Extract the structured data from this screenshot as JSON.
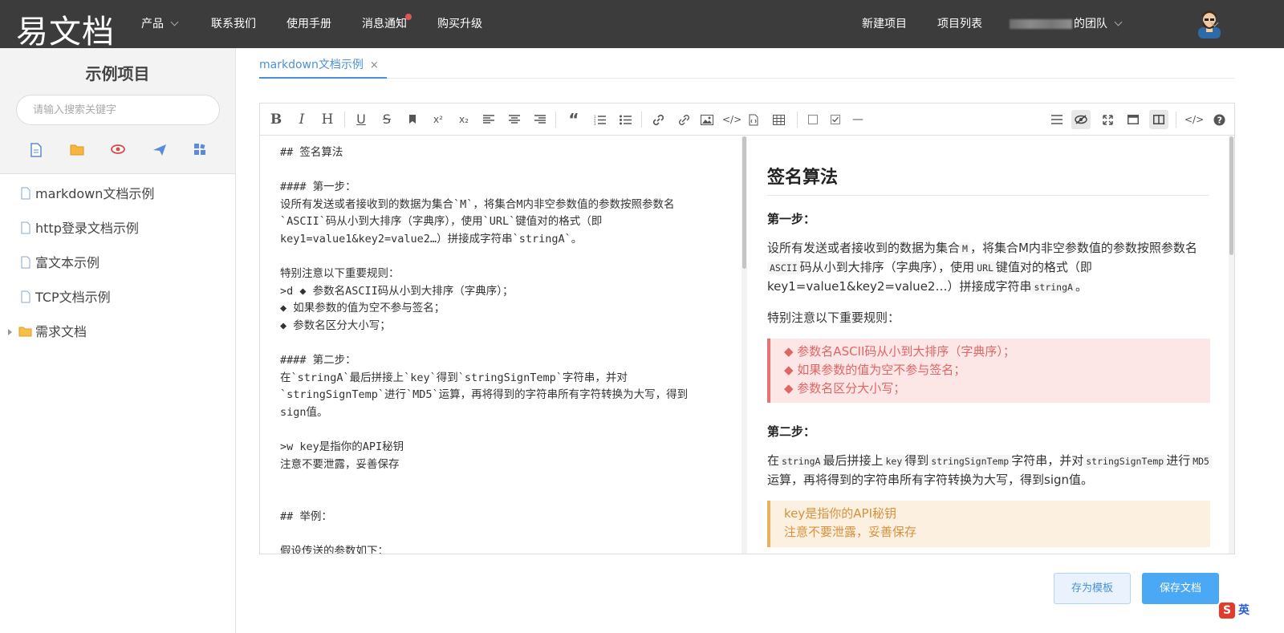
{
  "app": {
    "logo": "易文档",
    "nav": [
      {
        "label": "产品"
      },
      {
        "label": "联系我们"
      },
      {
        "label": "使用手册"
      },
      {
        "label": "消息通知"
      },
      {
        "label": "购买升级"
      }
    ],
    "right_nav": {
      "new_project": "新建项目",
      "project_list": "项目列表",
      "team_suffix": "的团队"
    }
  },
  "sidebar": {
    "title": "示例项目",
    "search_placeholder": "请输入搜索关键字",
    "items": [
      {
        "label": "markdown文档示例",
        "type": "doc"
      },
      {
        "label": "http登录文档示例",
        "type": "doc"
      },
      {
        "label": "富文本示例",
        "type": "doc"
      },
      {
        "label": "TCP文档示例",
        "type": "doc"
      },
      {
        "label": "需求文档",
        "type": "folder"
      }
    ]
  },
  "tab": {
    "label": "markdown文档示例",
    "close": "×"
  },
  "source_lines": [
    "## 签名算法",
    "",
    "#### 第一步：",
    "设所有发送或者接收到的数据为集合`M`，将集合M内非空参数值的参数按照参数名",
    "`ASCII`码从小到大排序（字典序），使用`URL`键值对的格式（即",
    "key1=value1&key2=value2…）拼接成字符串`stringA`。",
    "",
    "特别注意以下重要规则：",
    ">d ◆ 参数名ASCII码从小到大排序（字典序）；",
    "◆ 如果参数的值为空不参与签名；",
    "◆ 参数名区分大小写；",
    "",
    "#### 第二步：",
    "在`stringA`最后拼接上`key`得到`stringSignTemp`字符串，并对",
    "`stringSignTemp`进行`MD5`运算，再将得到的字符串所有字符转换为大写，得到",
    "sign值。",
    "",
    ">w key是指你的API秘钥",
    "注意不要泄露，妥善保存",
    "",
    "",
    "## 举例：",
    "",
    "假设传送的参数如下："
  ],
  "preview": {
    "h2": "签名算法",
    "step1": "第一步：",
    "p1": {
      "a": "设所有发送或者接收到的数据为集合",
      "code_m": "M",
      "b": "，将集合M内非空参数值的参数按照参数名",
      "code_ascii": "ASCII",
      "c": "码从小到大排序（字典序），使用",
      "code_url": "URL",
      "d": "键值对的格式（即key1=value1&key2=value2…）拼接成字符串",
      "code_stringa": "stringA",
      "e": "。"
    },
    "note": "特别注意以下重要规则：",
    "rules": [
      "◆ 参数名ASCII码从小到大排序（字典序）；",
      "◆ 如果参数的值为空不参与签名；",
      "◆ 参数名区分大小写；"
    ],
    "step2": "第二步：",
    "p2": {
      "a": "在",
      "code1": "stringA",
      "b": "最后拼接上",
      "code2": "key",
      "c": "得到",
      "code3": "stringSignTemp",
      "d": "字符串，并对",
      "code4": "stringSignTemp",
      "e": "进行",
      "code5": "MD5",
      "f": "运算，再将得到的字符串所有字符转换为大写，得到sign值。"
    },
    "warn": [
      "key是指你的API秘钥",
      "注意不要泄露，妥善保存"
    ]
  },
  "buttons": {
    "save_template": "存为模板",
    "save_doc": "保存文档"
  },
  "ime": {
    "s": "S",
    "t": "英"
  },
  "colors": {
    "topbar": "#3c3c3c",
    "accent": "#4a90d9",
    "danger_bg": "#fde6e6",
    "warn_bg": "#fcf1e0"
  }
}
